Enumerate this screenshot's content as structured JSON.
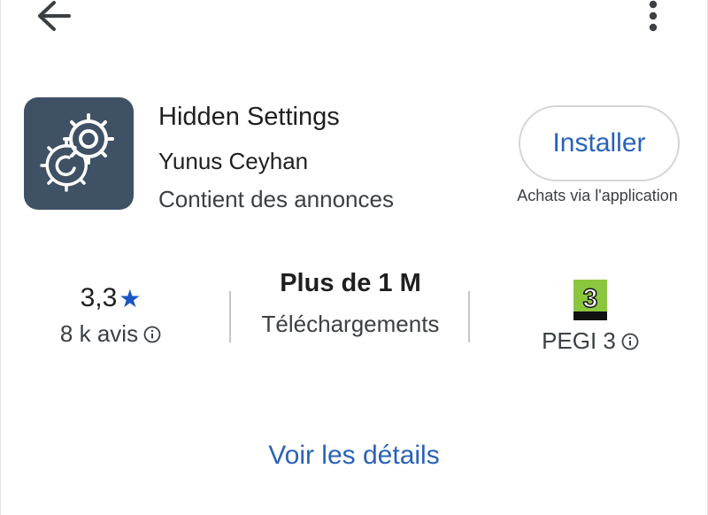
{
  "app": {
    "title": "Hidden Settings",
    "developer": "Yunus Ceyhan",
    "contains_ads": "Contient des annonces",
    "icon": "gears-icon"
  },
  "install": {
    "label": "Installer",
    "note": "Achats via l'application"
  },
  "stats": {
    "rating": {
      "value": "3,3",
      "star": "★",
      "reviews": "8 k avis"
    },
    "downloads": {
      "value": "Plus de 1 M",
      "label": "Téléchargements"
    },
    "age": {
      "badge": "3",
      "label": "PEGI 3"
    }
  },
  "details_link": "Voir les détails",
  "colors": {
    "accent": "#2a62b8",
    "star": "#1a56c4",
    "icon_bg": "#3f5164",
    "pegi_green": "#8bc63f"
  }
}
